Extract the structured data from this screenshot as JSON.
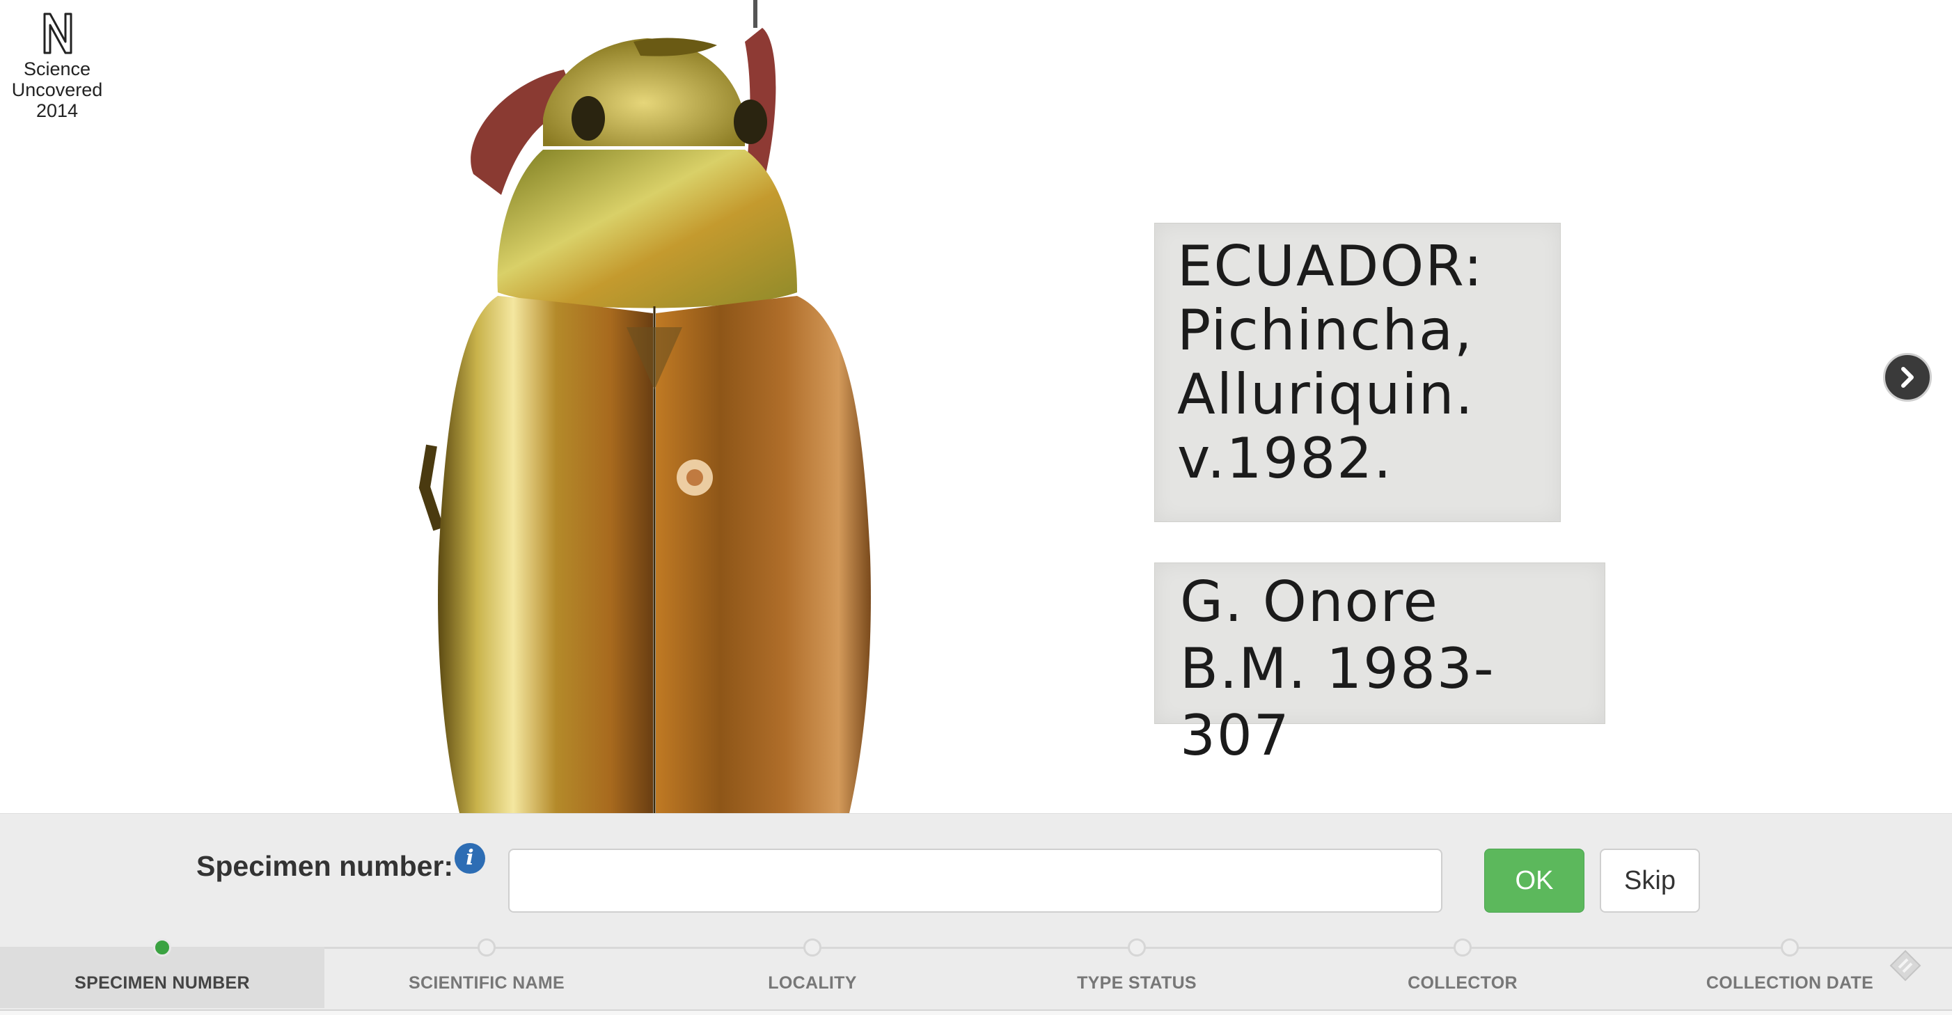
{
  "logo": {
    "lines": [
      "Science",
      "Uncovered",
      "2014"
    ]
  },
  "specimen_labels": {
    "label1": [
      "ECUADOR:",
      "Pichincha,",
      "Alluriquin.",
      "v.1982."
    ],
    "label2": [
      "G. Onore",
      "B.M. 1983-307"
    ]
  },
  "navigation": {
    "next_icon": "chevron-right-icon"
  },
  "form": {
    "field_label": "Specimen number:",
    "info_icon": "i",
    "input_value": "",
    "ok_label": "OK",
    "skip_label": "Skip"
  },
  "steps": [
    {
      "label": "SPECIMEN NUMBER",
      "active": true
    },
    {
      "label": "SCIENTIFIC NAME",
      "active": false
    },
    {
      "label": "LOCALITY",
      "active": false
    },
    {
      "label": "TYPE STATUS",
      "active": false
    },
    {
      "label": "COLLECTOR",
      "active": false
    },
    {
      "label": "COLLECTION DATE",
      "active": false
    }
  ],
  "colors": {
    "ok_green": "#5cb85c",
    "active_step_dot": "#3aa241",
    "info_blue": "#2d6db4",
    "form_background": "#ececec"
  }
}
